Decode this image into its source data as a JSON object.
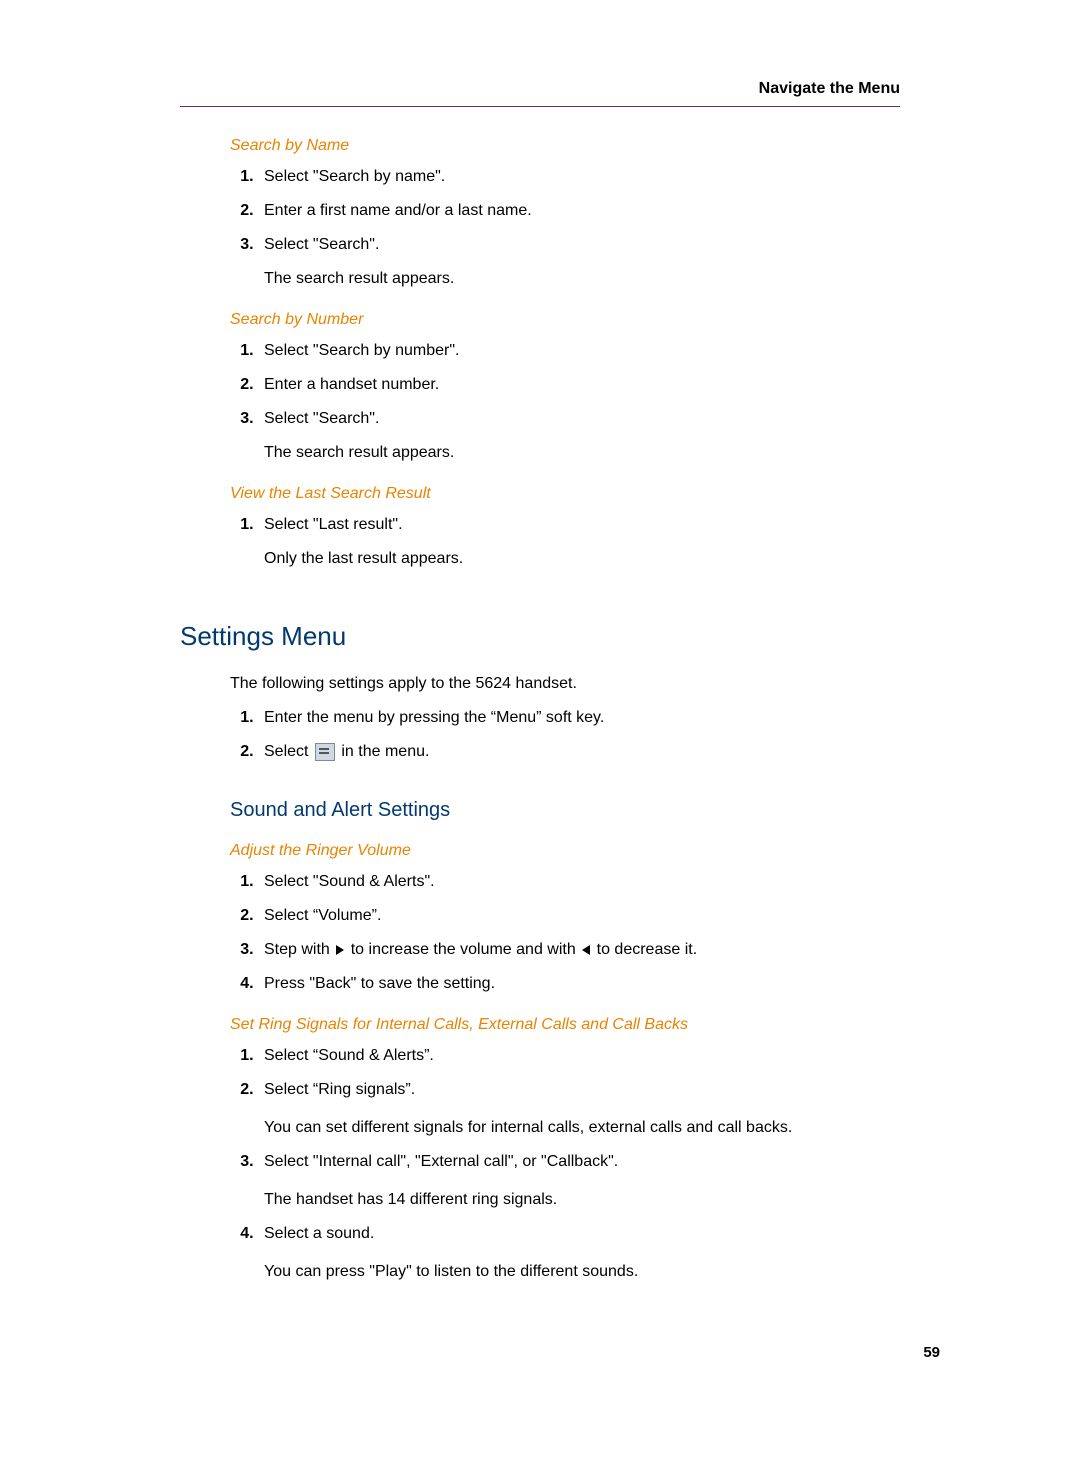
{
  "header": {
    "title": "Navigate the Menu"
  },
  "sections": {
    "searchByName": {
      "heading": "Search by Name",
      "steps": [
        "Select \"Search by name\".",
        "Enter a first name and/or a last name.",
        "Select \"Search\"."
      ],
      "followup": "The search result appears."
    },
    "searchByNumber": {
      "heading": "Search by Number",
      "steps": [
        "Select \"Search by number\".",
        "Enter a handset number.",
        "Select \"Search\"."
      ],
      "followup": "The search result appears."
    },
    "viewLast": {
      "heading": "View the Last Search Result",
      "steps": [
        "Select \"Last result\"."
      ],
      "followup": "Only the last result appears."
    },
    "settingsMenu": {
      "heading": "Settings Menu",
      "intro": "The following settings apply to the 5624 handset.",
      "steps_prefix_1": "Enter the menu by pressing the “Menu” soft key.",
      "steps_prefix_2a": "Select ",
      "steps_prefix_2b": " in the menu."
    },
    "soundAlert": {
      "heading": "Sound and Alert Settings"
    },
    "adjustRinger": {
      "heading": "Adjust the Ringer Volume",
      "step1": "Select \"Sound & Alerts\".",
      "step2": "Select “Volume”.",
      "step3a": "Step with ",
      "step3b": " to increase the volume and with ",
      "step3c": " to decrease it.",
      "step4": "Press \"Back\" to save the setting."
    },
    "ringSignals": {
      "heading": "Set Ring Signals for Internal Calls, External Calls and Call Backs",
      "step1": "Select “Sound & Alerts”.",
      "step2": "Select “Ring signals”.",
      "follow2": "You can set different signals for internal calls, external calls and call backs.",
      "step3": "Select \"Internal call\", \"External call\", or \"Callback\".",
      "follow3": "The handset has 14 different ring signals.",
      "step4": "Select a sound.",
      "follow4": "You can press \"Play\" to listen to the different sounds."
    }
  },
  "pageNumber": "59"
}
